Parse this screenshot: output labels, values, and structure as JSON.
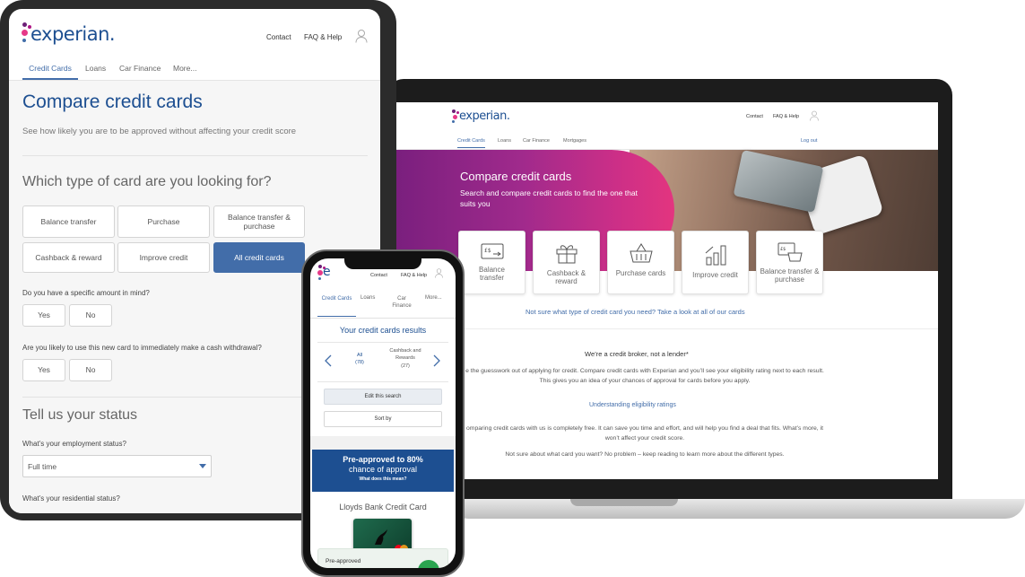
{
  "laptop": {
    "nav": {
      "contact": "Contact",
      "faq": "FAQ & Help",
      "logout": "Log out"
    },
    "tabs": [
      "Credit Cards",
      "Loans",
      "Car Finance",
      "Mortgages"
    ],
    "hero": {
      "title": "Compare credit cards",
      "subtitle": "Search and compare credit cards to find the one that suits you"
    },
    "tiles": [
      "Balance transfer",
      "Cashback & reward",
      "Purchase cards",
      "Improve credit",
      "Balance transfer & purchase"
    ],
    "link_all": "Not sure what type of credit card you need? Take a look at all of our cards",
    "broker": "We’re a credit broker, not a lender*",
    "para1": "e the guesswork out of applying for credit. Compare credit cards with Experian and you’ll see your eligibility rating next to each result. This gives you an idea of your chances of approval for cards before you apply.",
    "link_understand": "Understanding eligibility ratings",
    "para2": "omparing credit cards with us is completely free. It can save you time and effort, and will help you find a deal that fits. What’s more, it won’t affect your credit score.",
    "para3": "Not sure about what card you want? No problem – keep reading to learn more about the different types."
  },
  "tablet": {
    "logo": "experian.",
    "nav": {
      "contact": "Contact",
      "faq": "FAQ & Help"
    },
    "tabs": [
      "Credit Cards",
      "Loans",
      "Car Finance",
      "More..."
    ],
    "title": "Compare credit cards",
    "subtitle": "See how likely you are to be approved without affecting your credit score",
    "question": "Which type of card are you looking for?",
    "options": [
      "Balance transfer",
      "Purchase",
      "Balance transfer & purchase",
      "Cashback & reward",
      "Improve credit",
      "All credit cards"
    ],
    "q_amount": "Do you have a specific amount in mind?",
    "q_cash": "Are you likely to use this new card to immediately make a cash withdrawal?",
    "yes": "Yes",
    "no": "No",
    "status_title": "Tell us your status",
    "q_employment": "What’s your employment status?",
    "employment_value": "Full time",
    "q_residential": "What’s your residential status?"
  },
  "phone": {
    "nav": {
      "contact": "Contact",
      "faq": "FAQ & Help"
    },
    "tabs": [
      "Credit Cards",
      "Loans",
      "Car Finance",
      "More..."
    ],
    "results_title": "Your credit cards results",
    "cat_all": "All",
    "cat_all_count": "(78)",
    "cat_cash": "Cashback and Rewards",
    "cat_cash_count": "(27)",
    "edit": "Edit this search",
    "sort": "Sort by",
    "pre_title": "Pre-approved to 80%",
    "pre_sub": "chance of approval",
    "pre_link": "What does this mean?",
    "card_name": "Lloyds Bank Credit Card",
    "card_badge": "Pre-approved"
  },
  "colors": {
    "brand": "#1d4f91",
    "accent": "#426da9",
    "magenta": "#af1685",
    "purple": "#6d2077"
  }
}
